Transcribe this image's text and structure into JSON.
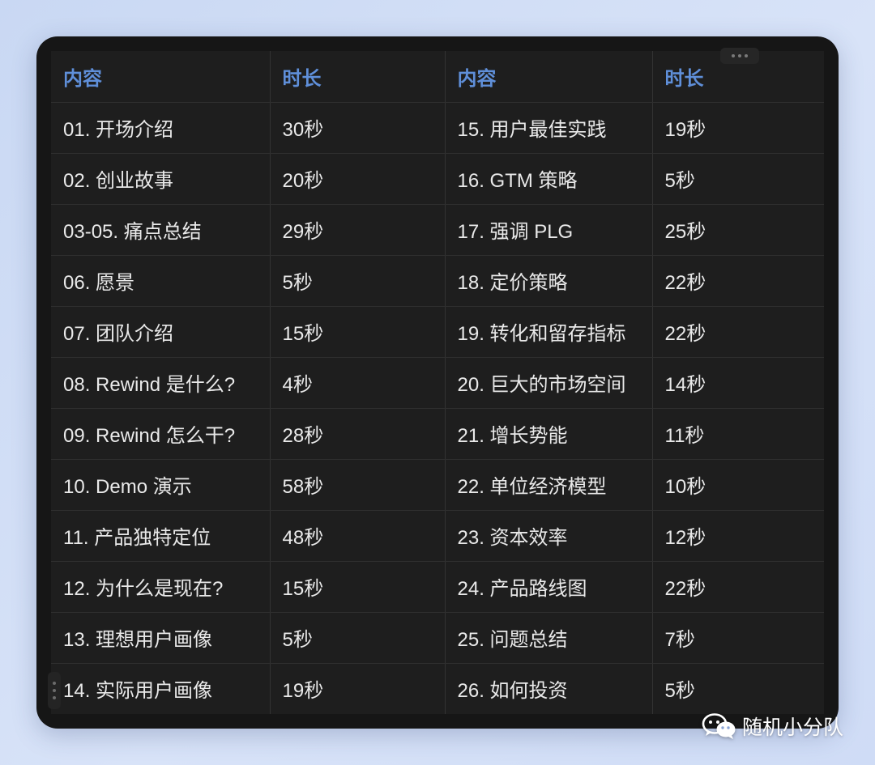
{
  "table": {
    "headers": [
      "内容",
      "时长",
      "内容",
      "时长"
    ],
    "rows": [
      [
        "01. 开场介绍",
        "30秒",
        "15. 用户最佳实践",
        "19秒"
      ],
      [
        "02. 创业故事",
        "20秒",
        "16. GTM 策略",
        "5秒"
      ],
      [
        "03-05. 痛点总结",
        "29秒",
        "17. 强调 PLG",
        "25秒"
      ],
      [
        "06. 愿景",
        "5秒",
        "18. 定价策略",
        "22秒"
      ],
      [
        "07. 团队介绍",
        "15秒",
        "19. 转化和留存指标",
        "22秒"
      ],
      [
        "08. Rewind 是什么?",
        "4秒",
        "20. 巨大的市场空间",
        "14秒"
      ],
      [
        "09. Rewind 怎么干?",
        "28秒",
        "21. 增长势能",
        "11秒"
      ],
      [
        "10. Demo 演示",
        "58秒",
        "22. 单位经济模型",
        "10秒"
      ],
      [
        "11. 产品独特定位",
        "48秒",
        "23. 资本效率",
        "12秒"
      ],
      [
        "12. 为什么是现在?",
        "15秒",
        "24. 产品路线图",
        "22秒"
      ],
      [
        "13. 理想用户画像",
        "5秒",
        "25. 问题总结",
        "7秒"
      ],
      [
        "14. 实际用户画像",
        "19秒",
        "26. 如何投资",
        "5秒"
      ]
    ]
  },
  "watermark": {
    "icon": "wechat-icon",
    "text": "随机小分队"
  },
  "colors": {
    "header_text": "#5f8fd9",
    "cell_text": "#e9e9e9",
    "table_bg": "#1e1e1e",
    "card_bg": "#161616"
  }
}
